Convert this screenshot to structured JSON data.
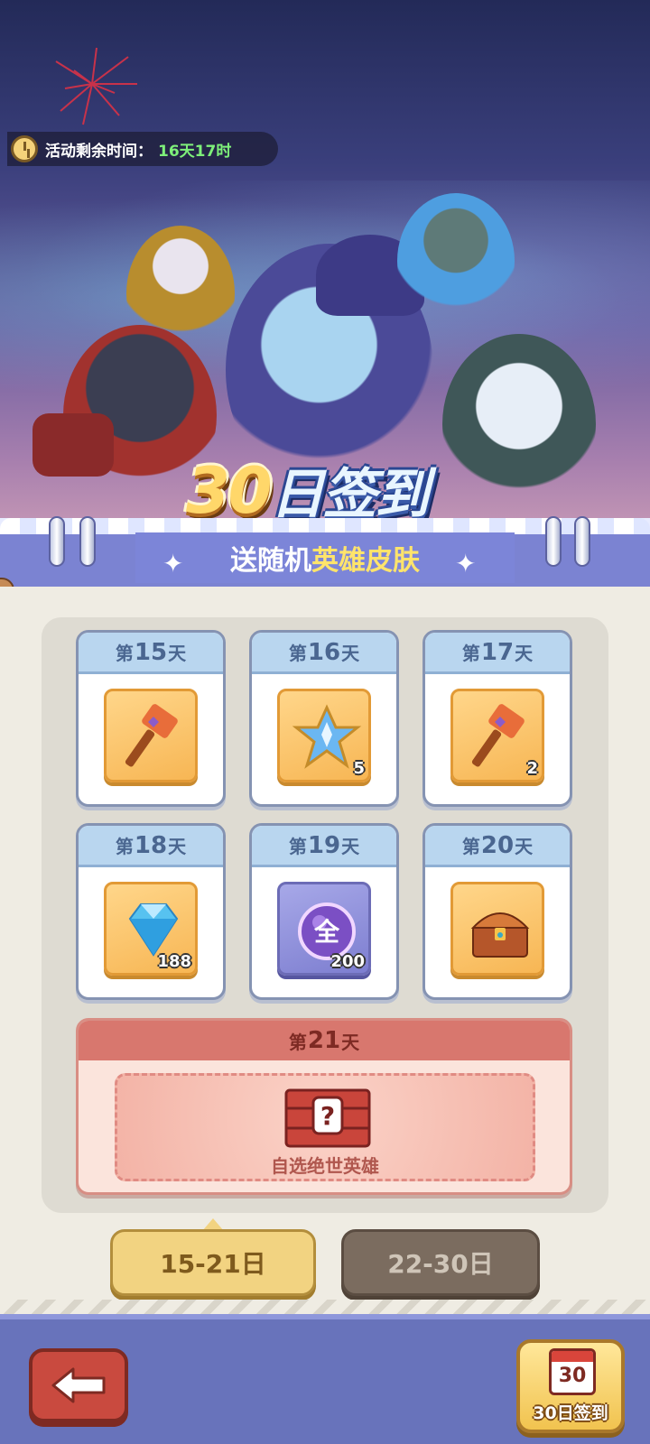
{
  "event": {
    "timer_label": "活动剩余时间：",
    "timer_value": "16天17时",
    "title_number": "30",
    "title_text": "日签到",
    "subtitle_pre": "送随机",
    "subtitle_highlight": "英雄皮肤"
  },
  "days": [
    {
      "prefix": "第",
      "num": "15",
      "suffix": "天",
      "item": "hammer-icon",
      "count": ""
    },
    {
      "prefix": "第",
      "num": "16",
      "suffix": "天",
      "item": "blue-star-icon",
      "count": "5"
    },
    {
      "prefix": "第",
      "num": "17",
      "suffix": "天",
      "item": "hammer-icon",
      "count": "2"
    },
    {
      "prefix": "第",
      "num": "18",
      "suffix": "天",
      "item": "diamond-icon",
      "count": "188"
    },
    {
      "prefix": "第",
      "num": "19",
      "suffix": "天",
      "item": "orb-icon",
      "count": "200",
      "orb_text": "全"
    },
    {
      "prefix": "第",
      "num": "20",
      "suffix": "天",
      "item": "treasure-chest-icon",
      "count": ""
    }
  ],
  "day21": {
    "prefix": "第",
    "num": "21",
    "suffix": "天",
    "label": "自选绝世英雄",
    "item": "mystery-chest-icon"
  },
  "tabs": {
    "active": "15-21日",
    "inactive": "22-30日"
  },
  "bottom": {
    "signin_num": "30",
    "signin_label": "30日签到"
  },
  "colors": {
    "accent_gold": "#f2d381",
    "highlight_yellow": "#ffe46b",
    "timer_green": "#7ef07a",
    "ribbon_purple": "#7c85d8"
  }
}
